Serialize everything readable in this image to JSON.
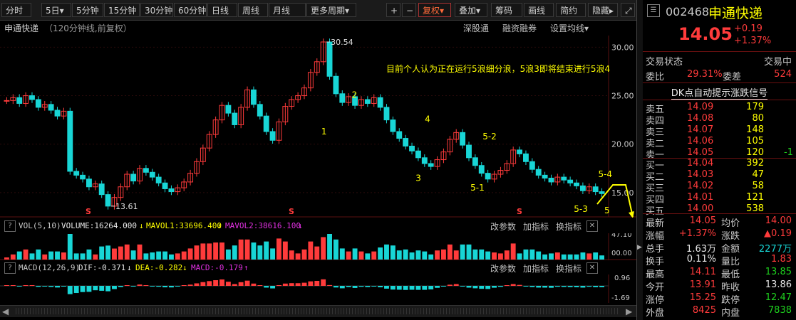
{
  "toolbar": {
    "tabs": [
      "分时",
      "5日▾",
      "5分钟",
      "15分钟",
      "30分钟",
      "60分钟",
      "日线",
      "周线",
      "月线",
      "更多周期▾"
    ],
    "right": [
      "+",
      "−",
      "复权▾",
      "叠加▾",
      "筹码",
      "画线",
      "简约",
      "隐藏▸"
    ],
    "close_icon": "⤢"
  },
  "chart_header": {
    "name": "申通快递",
    "subtitle": "（120分钟线,前复权）",
    "links": [
      "深股通",
      "融资融券",
      "设置均线▾"
    ]
  },
  "chart_data": {
    "type": "candlestick",
    "title": "申通快递（120分钟线,前复权）",
    "y_ticks": [
      "30.00",
      "25.00",
      "20.00",
      "15.00"
    ],
    "ylim": [
      12.5,
      31.2
    ],
    "price_series": [
      24.5,
      24.8,
      24.2,
      25.0,
      24.6,
      23.8,
      24.1,
      23.5,
      22.9,
      23.4,
      17.2,
      16.8,
      16.4,
      15.6,
      15.9,
      14.8,
      13.61,
      14.5,
      15.6,
      16.9,
      16.2,
      17.5,
      17.1,
      16.6,
      16.0,
      15.4,
      15.1,
      15.5,
      16.1,
      17.0,
      18.2,
      19.6,
      21.0,
      22.5,
      24.0,
      23.2,
      22.0,
      23.8,
      25.6,
      24.1,
      22.9,
      21.3,
      20.4,
      22.3,
      23.9,
      24.6,
      25.0,
      25.8,
      27.4,
      28.5,
      30.54,
      27.0,
      25.2,
      24.3,
      24.9,
      24.0,
      24.6,
      24.2,
      24.8,
      23.8,
      22.5,
      21.3,
      20.6,
      19.8,
      19.3,
      18.6,
      18.0,
      17.7,
      18.4,
      19.2,
      20.5,
      21.2,
      19.9,
      18.6,
      17.8,
      17.0,
      16.4,
      16.9,
      17.3,
      18.0,
      19.4,
      19.0,
      18.2,
      17.4,
      16.8,
      16.5,
      16.1,
      16.6,
      16.3,
      16.0,
      15.7,
      15.2,
      15.6,
      15.1,
      14.9
    ],
    "high_label": "30.54",
    "low_label": "13.61",
    "annotation": "目前个人认为正在运行5浪细分浪，5浪3即将结束进行5浪4",
    "wave_labels": [
      {
        "text": "1",
        "x": 0.535,
        "y": 21.0
      },
      {
        "text": "2",
        "x": 0.585,
        "y": 24.8
      },
      {
        "text": "3",
        "x": 0.69,
        "y": 16.2
      },
      {
        "text": "4",
        "x": 0.705,
        "y": 22.3
      },
      {
        "text": "5-1",
        "x": 0.78,
        "y": 15.2
      },
      {
        "text": "5-2",
        "x": 0.8,
        "y": 20.5
      },
      {
        "text": "5-3",
        "x": 0.95,
        "y": 13.0
      },
      {
        "text": "5-4",
        "x": 0.99,
        "y": 16.6
      },
      {
        "text": "5",
        "x": 1.0,
        "y": 11.0
      }
    ],
    "s_markers": [
      "S",
      "S",
      "S"
    ],
    "volume": {
      "label": "VOL(5,10)",
      "volume": "VOLUME:16264.000",
      "mavol1": "MAVOL1:33696.400",
      "mavol2": "MAVOL2:38616.100",
      "y_ticks": [
        "47.10",
        "00.00"
      ]
    },
    "macd": {
      "label": "MACD(12,26,9)",
      "dif": "DIF:-0.371",
      "dea": "DEA:-0.282",
      "macd": "MACD:-0.179",
      "y_ticks": [
        "0.96",
        "-1.69"
      ]
    }
  },
  "indicator_buttons": [
    "改参数",
    "加指标",
    "换指标"
  ],
  "panel": {
    "code": "002468",
    "name": "申通快递",
    "price": "14.05",
    "change": "+0.19",
    "change_pct": "+1.37%",
    "status_label": "交易状态",
    "status_value": "交易中",
    "webi_label": "委比",
    "webi_value": "29.31%",
    "weicha_label": "委差",
    "weicha_value": "524",
    "dk_link": "DK点自动提示涨跌信号",
    "asks": [
      {
        "label": "卖五",
        "price": "14.09",
        "vol": "179",
        "chg": ""
      },
      {
        "label": "卖四",
        "price": "14.08",
        "vol": "80",
        "chg": ""
      },
      {
        "label": "卖三",
        "price": "14.07",
        "vol": "148",
        "chg": ""
      },
      {
        "label": "卖二",
        "price": "14.06",
        "vol": "105",
        "chg": ""
      },
      {
        "label": "卖一",
        "price": "14.05",
        "vol": "120",
        "chg": "-1"
      }
    ],
    "bids": [
      {
        "label": "买一",
        "price": "14.04",
        "vol": "392"
      },
      {
        "label": "买二",
        "price": "14.03",
        "vol": "47"
      },
      {
        "label": "买三",
        "price": "14.02",
        "vol": "58"
      },
      {
        "label": "买四",
        "price": "14.01",
        "vol": "121"
      },
      {
        "label": "买五",
        "price": "14.00",
        "vol": "538"
      }
    ],
    "stats": [
      {
        "l1": "最新",
        "v1": "14.05",
        "c1": "red",
        "l2": "均价",
        "v2": "14.00",
        "c2": "red"
      },
      {
        "l1": "涨幅",
        "v1": "+1.37%",
        "c1": "red",
        "l2": "涨跌",
        "v2": "▲0.19",
        "c2": "red"
      },
      {
        "l1": "总手",
        "v1": "1.63万",
        "c1": "white",
        "l2": "金额",
        "v2": "2277万",
        "c2": "cyan"
      },
      {
        "l1": "换手",
        "v1": "0.11%",
        "c1": "white",
        "l2": "量比",
        "v2": "1.83",
        "c2": "red"
      },
      {
        "l1": "最高",
        "v1": "14.11",
        "c1": "red",
        "l2": "最低",
        "v2": "13.85",
        "c2": "green"
      },
      {
        "l1": "今开",
        "v1": "13.91",
        "c1": "red",
        "l2": "昨收",
        "v2": "13.86",
        "c2": "white"
      },
      {
        "l1": "涨停",
        "v1": "15.25",
        "c1": "red",
        "l2": "跌停",
        "v2": "12.47",
        "c2": "green"
      },
      {
        "l1": "外盘",
        "v1": "8425",
        "c1": "red",
        "l2": "内盘",
        "v2": "7838",
        "c2": "green"
      }
    ]
  }
}
